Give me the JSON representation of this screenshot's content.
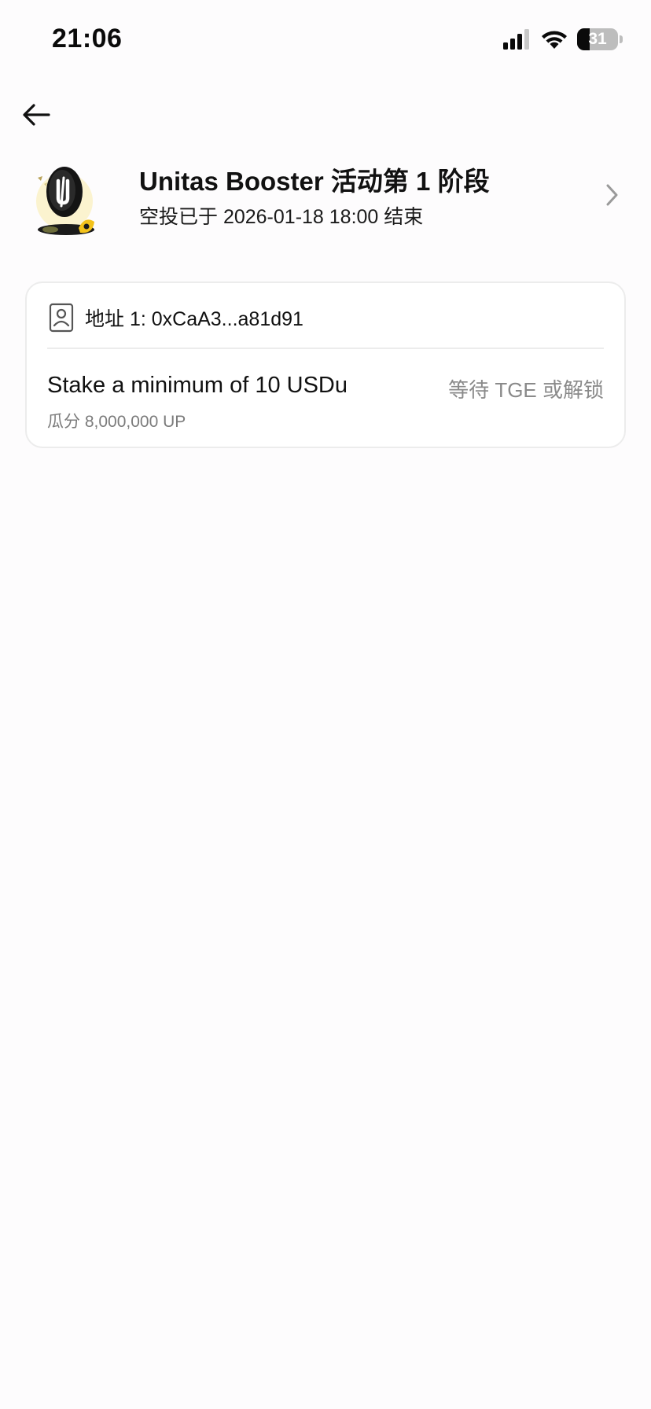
{
  "status_bar": {
    "time": "21:06",
    "battery_level": "31",
    "battery_fraction": 0.31,
    "icons": [
      "cellular-signal-icon",
      "wifi-icon",
      "battery-icon"
    ]
  },
  "nav": {
    "back_icon": "arrow-left-icon"
  },
  "campaign": {
    "logo_icon": "unitas-campaign-logo",
    "title": "Unitas Booster 活动第 1 阶段",
    "subtitle": "空投已于 2026-01-18 18:00 结束",
    "chevron_icon": "chevron-right-icon"
  },
  "task_card": {
    "address_icon": "wallet-address-icon",
    "address_label": "地址 1: 0xCaA3...a81d91",
    "task_title": "Stake a minimum of 10 USDu",
    "reward": "瓜分 8,000,000 UP",
    "status": "等待 TGE 或解锁"
  },
  "colors": {
    "background": "#fdfcfd",
    "text_primary": "#111111",
    "text_secondary": "#7b7b7b",
    "card_border": "#ececec",
    "logo_accent": "#f3c21b"
  }
}
